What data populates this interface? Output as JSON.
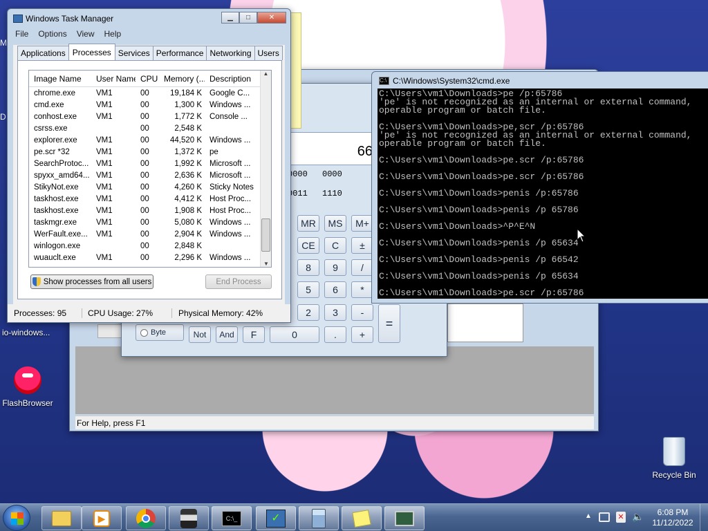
{
  "desktop": {
    "icons": [
      {
        "label": "io-windows..."
      },
      {
        "label": "FlashBrowser"
      },
      {
        "label": "Recycle Bin"
      }
    ]
  },
  "task_manager": {
    "title": "Windows Task Manager",
    "menu": [
      "File",
      "Options",
      "View",
      "Help"
    ],
    "tabs": [
      "Applications",
      "Processes",
      "Services",
      "Performance",
      "Networking",
      "Users"
    ],
    "active_tab": "Processes",
    "columns": [
      "Image Name",
      "User Name",
      "CPU",
      "Memory (...",
      "Description"
    ],
    "rows": [
      [
        "chrome.exe",
        "VM1",
        "00",
        "19,184 K",
        "Google C..."
      ],
      [
        "cmd.exe",
        "VM1",
        "00",
        "1,300 K",
        "Windows ..."
      ],
      [
        "conhost.exe",
        "VM1",
        "00",
        "1,772 K",
        "Console ..."
      ],
      [
        "csrss.exe",
        "",
        "00",
        "2,548 K",
        ""
      ],
      [
        "explorer.exe",
        "VM1",
        "00",
        "44,520 K",
        "Windows ..."
      ],
      [
        "pe.scr *32",
        "VM1",
        "00",
        "1,372 K",
        "pe"
      ],
      [
        "SearchProtoc...",
        "VM1",
        "00",
        "1,992 K",
        "Microsoft ..."
      ],
      [
        "spyxx_amd64...",
        "VM1",
        "00",
        "2,636 K",
        "Microsoft ..."
      ],
      [
        "StikyNot.exe",
        "VM1",
        "00",
        "4,260 K",
        "Sticky Notes"
      ],
      [
        "taskhost.exe",
        "VM1",
        "00",
        "4,412 K",
        "Host Proc..."
      ],
      [
        "taskhost.exe",
        "VM1",
        "00",
        "1,908 K",
        "Host Proc..."
      ],
      [
        "taskmgr.exe",
        "VM1",
        "00",
        "5,080 K",
        "Windows ..."
      ],
      [
        "WerFault.exe...",
        "VM1",
        "00",
        "2,904 K",
        "Windows ..."
      ],
      [
        "winlogon.exe",
        "",
        "00",
        "2,848 K",
        ""
      ],
      [
        "wuauclt.exe",
        "VM1",
        "00",
        "2,296 K",
        "Windows ..."
      ]
    ],
    "show_all_label": "Show processes from all users",
    "end_process_label": "End Process",
    "status": {
      "processes": "Processes: 95",
      "cpu": "CPU Usage: 27%",
      "memory": "Physical Memory: 42%"
    }
  },
  "calculator": {
    "display": "66",
    "bits_row1": [
      "0000",
      "0000"
    ],
    "bits_row2": [
      "0011",
      "1110"
    ],
    "buttons": [
      "MR",
      "MS",
      "M+",
      "CE",
      "C",
      "±",
      "8",
      "9",
      "/",
      "5",
      "6",
      "*",
      "2",
      "3",
      "-",
      "="
    ],
    "bottom": {
      "byte": "Byte",
      "not": "Not",
      "and": "And",
      "f": "F",
      "zero": "0",
      "dot": ".",
      "plus": "+"
    }
  },
  "back_window": {
    "status": "For Help, press F1"
  },
  "cmd": {
    "title": "C:\\Windows\\System32\\cmd.exe",
    "lines": [
      "C:\\Users\\vm1\\Downloads>pe /p:65786",
      "'pe' is not recognized as an internal or external command,",
      "operable program or batch file.",
      "",
      "C:\\Users\\vm1\\Downloads>pe,scr /p:65786",
      "'pe' is not recognized as an internal or external command,",
      "operable program or batch file.",
      "",
      "C:\\Users\\vm1\\Downloads>pe.scr /p:65786",
      "",
      "C:\\Users\\vm1\\Downloads>pe.scr /p:65786",
      "",
      "C:\\Users\\vm1\\Downloads>penis /p:65786",
      "",
      "C:\\Users\\vm1\\Downloads>penis /p 65786",
      "",
      "C:\\Users\\vm1\\Downloads>^P^E^N",
      "",
      "C:\\Users\\vm1\\Downloads>penis /p 65634",
      "",
      "C:\\Users\\vm1\\Downloads>penis /p 66542",
      "",
      "C:\\Users\\vm1\\Downloads>penis /p 65634",
      "",
      "C:\\Users\\vm1\\Downloads>pe.scr /p:65786"
    ]
  },
  "taskbar": {
    "time": "6:08 PM",
    "date": "11/12/2022"
  },
  "colors": {
    "taskbar": "#4b6691",
    "cmd_bg": "#000000",
    "frame": "#c7d7ea"
  }
}
